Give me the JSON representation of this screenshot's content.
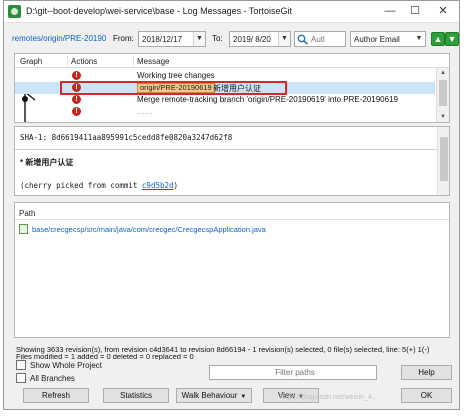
{
  "window": {
    "title": "D:\\git--boot-develop\\wei-service\\base - Log Messages - TortoiseGit",
    "minimize": "—",
    "maximize": "☐",
    "close": "✕"
  },
  "filter": {
    "ref_link": "remotes/origin/PRE-20190...",
    "from_label": "From:",
    "from_date": "2018/12/17",
    "to_label": "To:",
    "to_date": "2019/ 8/20",
    "search_placeholder": "Autl",
    "field_select": "Author Email"
  },
  "log": {
    "columns": [
      "Graph",
      "Actions",
      "Message"
    ],
    "rows": [
      {
        "message": "Working tree changes",
        "action": "!"
      },
      {
        "branch": "origin/PRE-20190619",
        "message": "新增用户认证",
        "action": "!"
      },
      {
        "message": "Merge remote-tracking branch 'origin/PRE-20190619' into PRE-20190619",
        "action": "!"
      },
      {
        "message": "……",
        "action": "!"
      }
    ]
  },
  "detail": {
    "sha": "SHA-1: 8d6619411aa895991c5cedd8fe0820a3247d62f8",
    "title": "* 新增用户认证",
    "cherry_prefix": "(cherry picked from commit ",
    "cherry_commit": "c9d5b2d",
    "cherry_suffix": ")"
  },
  "files": {
    "header": "Path",
    "items": [
      "base/crecgecsp/src/main/java/com/crecgec/CrecgecspApplication.java"
    ]
  },
  "status": {
    "line1": "Showing 3633 revision(s), from revision c4d3641 to revision 8d66194 - 1 revision(s) selected, 0 file(s) selected, line: 5(+) 1(-)",
    "line2": "Files modified = 1 added = 0 deleted = 0 replaced = 0"
  },
  "options": {
    "show_whole_project": "Show Whole Project",
    "all_branches": "All Branches",
    "filter_placeholder": "Filter paths"
  },
  "buttons": {
    "help": "Help",
    "refresh": "Refresh",
    "statistics": "Statistics",
    "walk_behaviour": "Walk Behaviour",
    "view": "View",
    "ok": "OK"
  },
  "watermark": "https://blog.csdn.net/weixin_4..."
}
